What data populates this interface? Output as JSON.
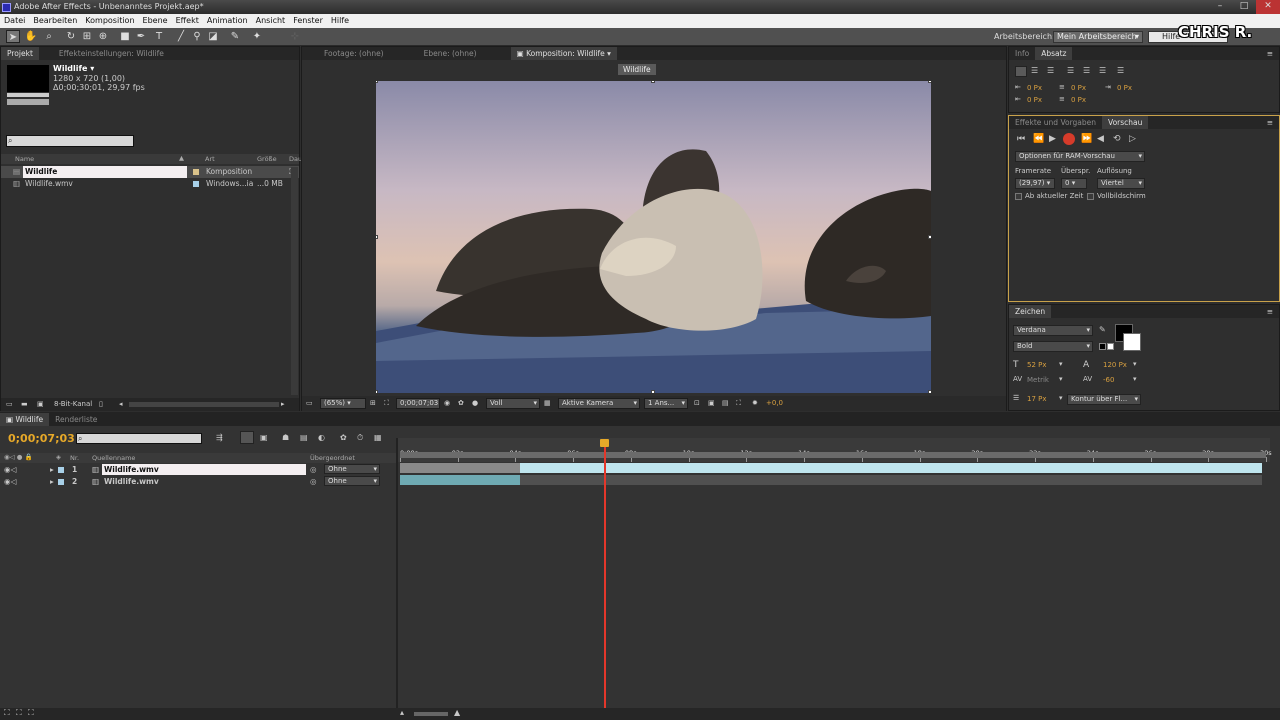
{
  "window": {
    "title": "Adobe After Effects - Unbenanntes Projekt.aep*"
  },
  "menu": [
    "Datei",
    "Bearbeiten",
    "Komposition",
    "Ebene",
    "Effekt",
    "Animation",
    "Ansicht",
    "Fenster",
    "Hilfe"
  ],
  "toolbar": {
    "workspace_label": "Arbeitsbereich:",
    "workspace_value": "Mein Arbeitsbereich",
    "help_placeholder": "Hilfe"
  },
  "watermark": "CHRIS R.",
  "project_panel": {
    "tabs": [
      "Projekt",
      "Effekteinstellungen: Wildlife"
    ],
    "selected_name": "Wildlife ▾",
    "selected_dims": "1280 x 720 (1,00)",
    "selected_duration": "Δ0;00;30;01, 29,97 fps",
    "columns": [
      "Name",
      "Art",
      "Größe",
      "Dau"
    ],
    "items": [
      {
        "name": "Wildlife",
        "type": "Komposition",
        "size": ""
      },
      {
        "name": "Wildlife.wmv",
        "type": "Windows...ia",
        "size": "...0 MB"
      }
    ],
    "bit_depth": "8-Bit-Kanal"
  },
  "comp_panel": {
    "tabs": [
      "Footage: (ohne)",
      "Ebene: (ohne)",
      "Komposition: Wildlife"
    ],
    "sub_tab": "Wildlife",
    "zoom": "(65%)",
    "timecode": "0;00;07;03",
    "resolution": "Voll",
    "camera": "Aktive Kamera",
    "views": "1 Ans...",
    "exposure": "+0,0"
  },
  "info_panel": {
    "tabs": [
      "Info",
      "Absatz"
    ],
    "indent_values": [
      "0 Px",
      "0 Px",
      "0 Px",
      "0 Px",
      "0 Px"
    ]
  },
  "preview_panel": {
    "tabs": [
      "Effekte und Vorgaben",
      "Vorschau"
    ],
    "ram_options": "Optionen für RAM-Vorschau",
    "framerate_label": "Framerate",
    "skip_label": "Überspr.",
    "resolution_label": "Auflösung",
    "framerate_value": "(29,97)",
    "skip_value": "0",
    "resolution_value": "Viertel",
    "from_current": "Ab aktueller Zeit",
    "fullscreen": "Vollbildschirm"
  },
  "character_panel": {
    "tab": "Zeichen",
    "font": "Verdana",
    "style": "Bold",
    "size": "52 Px",
    "leading": "120 Px",
    "kerning": "Metrik",
    "tracking": "-60",
    "stroke": "17 Px",
    "stroke_mode": "Kontur über Fl..."
  },
  "timeline": {
    "tabs": [
      "Wildlife",
      "Renderliste"
    ],
    "timecode": "0;00;07;03",
    "columns": [
      "Nr.",
      "Quellenname",
      "Übergeordnet"
    ],
    "layers": [
      {
        "num": "1",
        "name": "Wildlife.wmv",
        "parent": "Ohne"
      },
      {
        "num": "2",
        "name": "Wildlife.wmv",
        "parent": "Ohne"
      }
    ],
    "ticks": [
      "0:00s",
      "02s",
      "04s",
      "06s",
      "08s",
      "10s",
      "12s",
      "14s",
      "16s",
      "18s",
      "20s",
      "22s",
      "24s",
      "26s",
      "28s",
      "30s"
    ],
    "playhead_seconds": 7.1,
    "duration_seconds": 30
  }
}
